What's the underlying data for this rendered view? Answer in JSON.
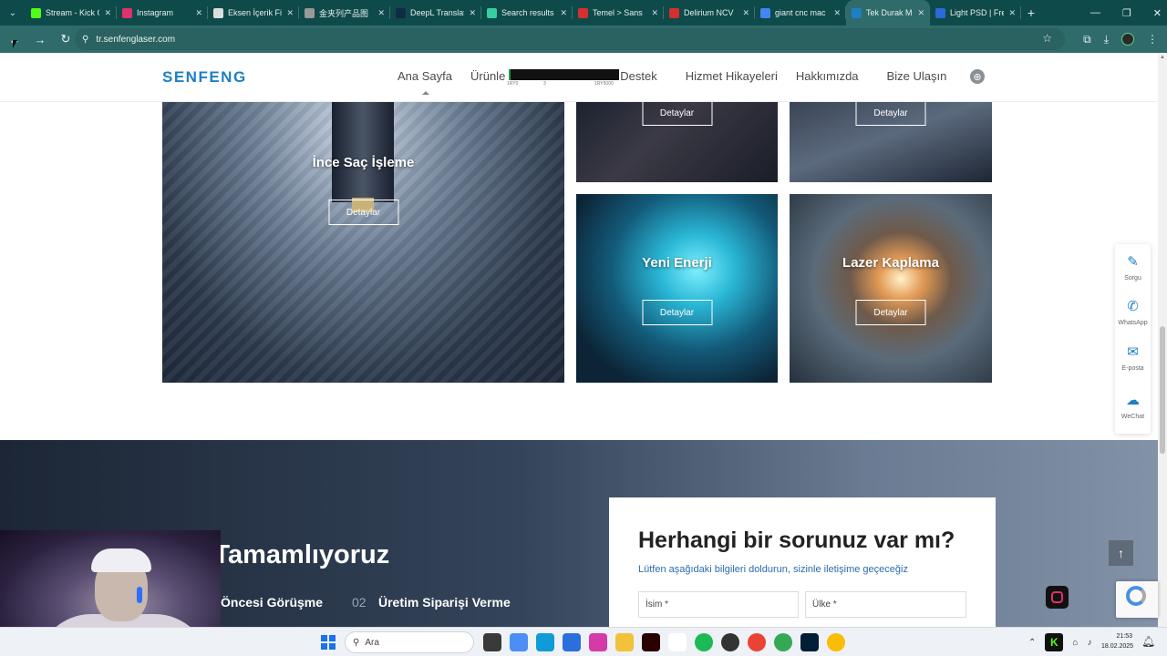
{
  "browser": {
    "tabs": [
      {
        "title": "Stream - Kick C",
        "color": "#53fc18"
      },
      {
        "title": "Instagram",
        "color": "#e1306c"
      },
      {
        "title": "Eksen İçerik Fi",
        "color": "#dddddd"
      },
      {
        "title": "金夹列产品图",
        "color": "#999999"
      },
      {
        "title": "DeepL Translat",
        "color": "#0f2b46"
      },
      {
        "title": "Search results",
        "color": "#35d0a1"
      },
      {
        "title": "Temel > Sans",
        "color": "#d62f2f"
      },
      {
        "title": "Delirium NCV",
        "color": "#d62f2f"
      },
      {
        "title": "giant cnc mac",
        "color": "#4285f4"
      },
      {
        "title": "Tek Durak Met",
        "color": "#1e7fc4"
      },
      {
        "title": "Light PSD | Fre",
        "color": "#2a6bd8"
      }
    ],
    "active_tab_index": 9,
    "new_tab": "+",
    "url": "tr.senfenglaser.com"
  },
  "site": {
    "logo": "SENFENG",
    "menu": [
      "Ana Sayfa",
      "Ürünle",
      "Destek",
      "Hizmet Hikayeleri",
      "Hakkımızda",
      "Bize Ulaşın"
    ],
    "tooltip_ticks": [
      "1RY0",
      "3",
      "1RY5000"
    ]
  },
  "tiles": {
    "big": {
      "title": "İnce Saç İşleme",
      "button": "Detaylar"
    },
    "top_mid": {
      "button": "Detaylar"
    },
    "top_right": {
      "button": "Detaylar"
    },
    "bottom_mid": {
      "title": "Yeni Enerji",
      "button": "Detaylar"
    },
    "bottom_right": {
      "title": "Lazer Kaplama",
      "button": "Detaylar"
    }
  },
  "side_widget": [
    {
      "icon": "edit-icon",
      "label": "Sorgu"
    },
    {
      "icon": "whatsapp-icon",
      "label": "WhatsApp"
    },
    {
      "icon": "mail-icon",
      "label": "E-posta"
    },
    {
      "icon": "wechat-icon",
      "label": "WeChat"
    }
  ],
  "lower": {
    "title": "asıl Tamamlıyoruz",
    "step1": "Öncesi Görüşme",
    "step2_num": "02",
    "step2": "Üretim Siparişi Verme"
  },
  "form": {
    "title": "Herhangi bir sorunuz var mı?",
    "subtitle": "Lütfen aşağıdaki bilgileri doldurun, sizinle iletişime geçeceğiz",
    "name_placeholder": "İsim *",
    "country_placeholder": "Ülke *"
  },
  "taskbar": {
    "search_placeholder": "Ara",
    "time": "21:53",
    "date": "18.02.2025"
  }
}
